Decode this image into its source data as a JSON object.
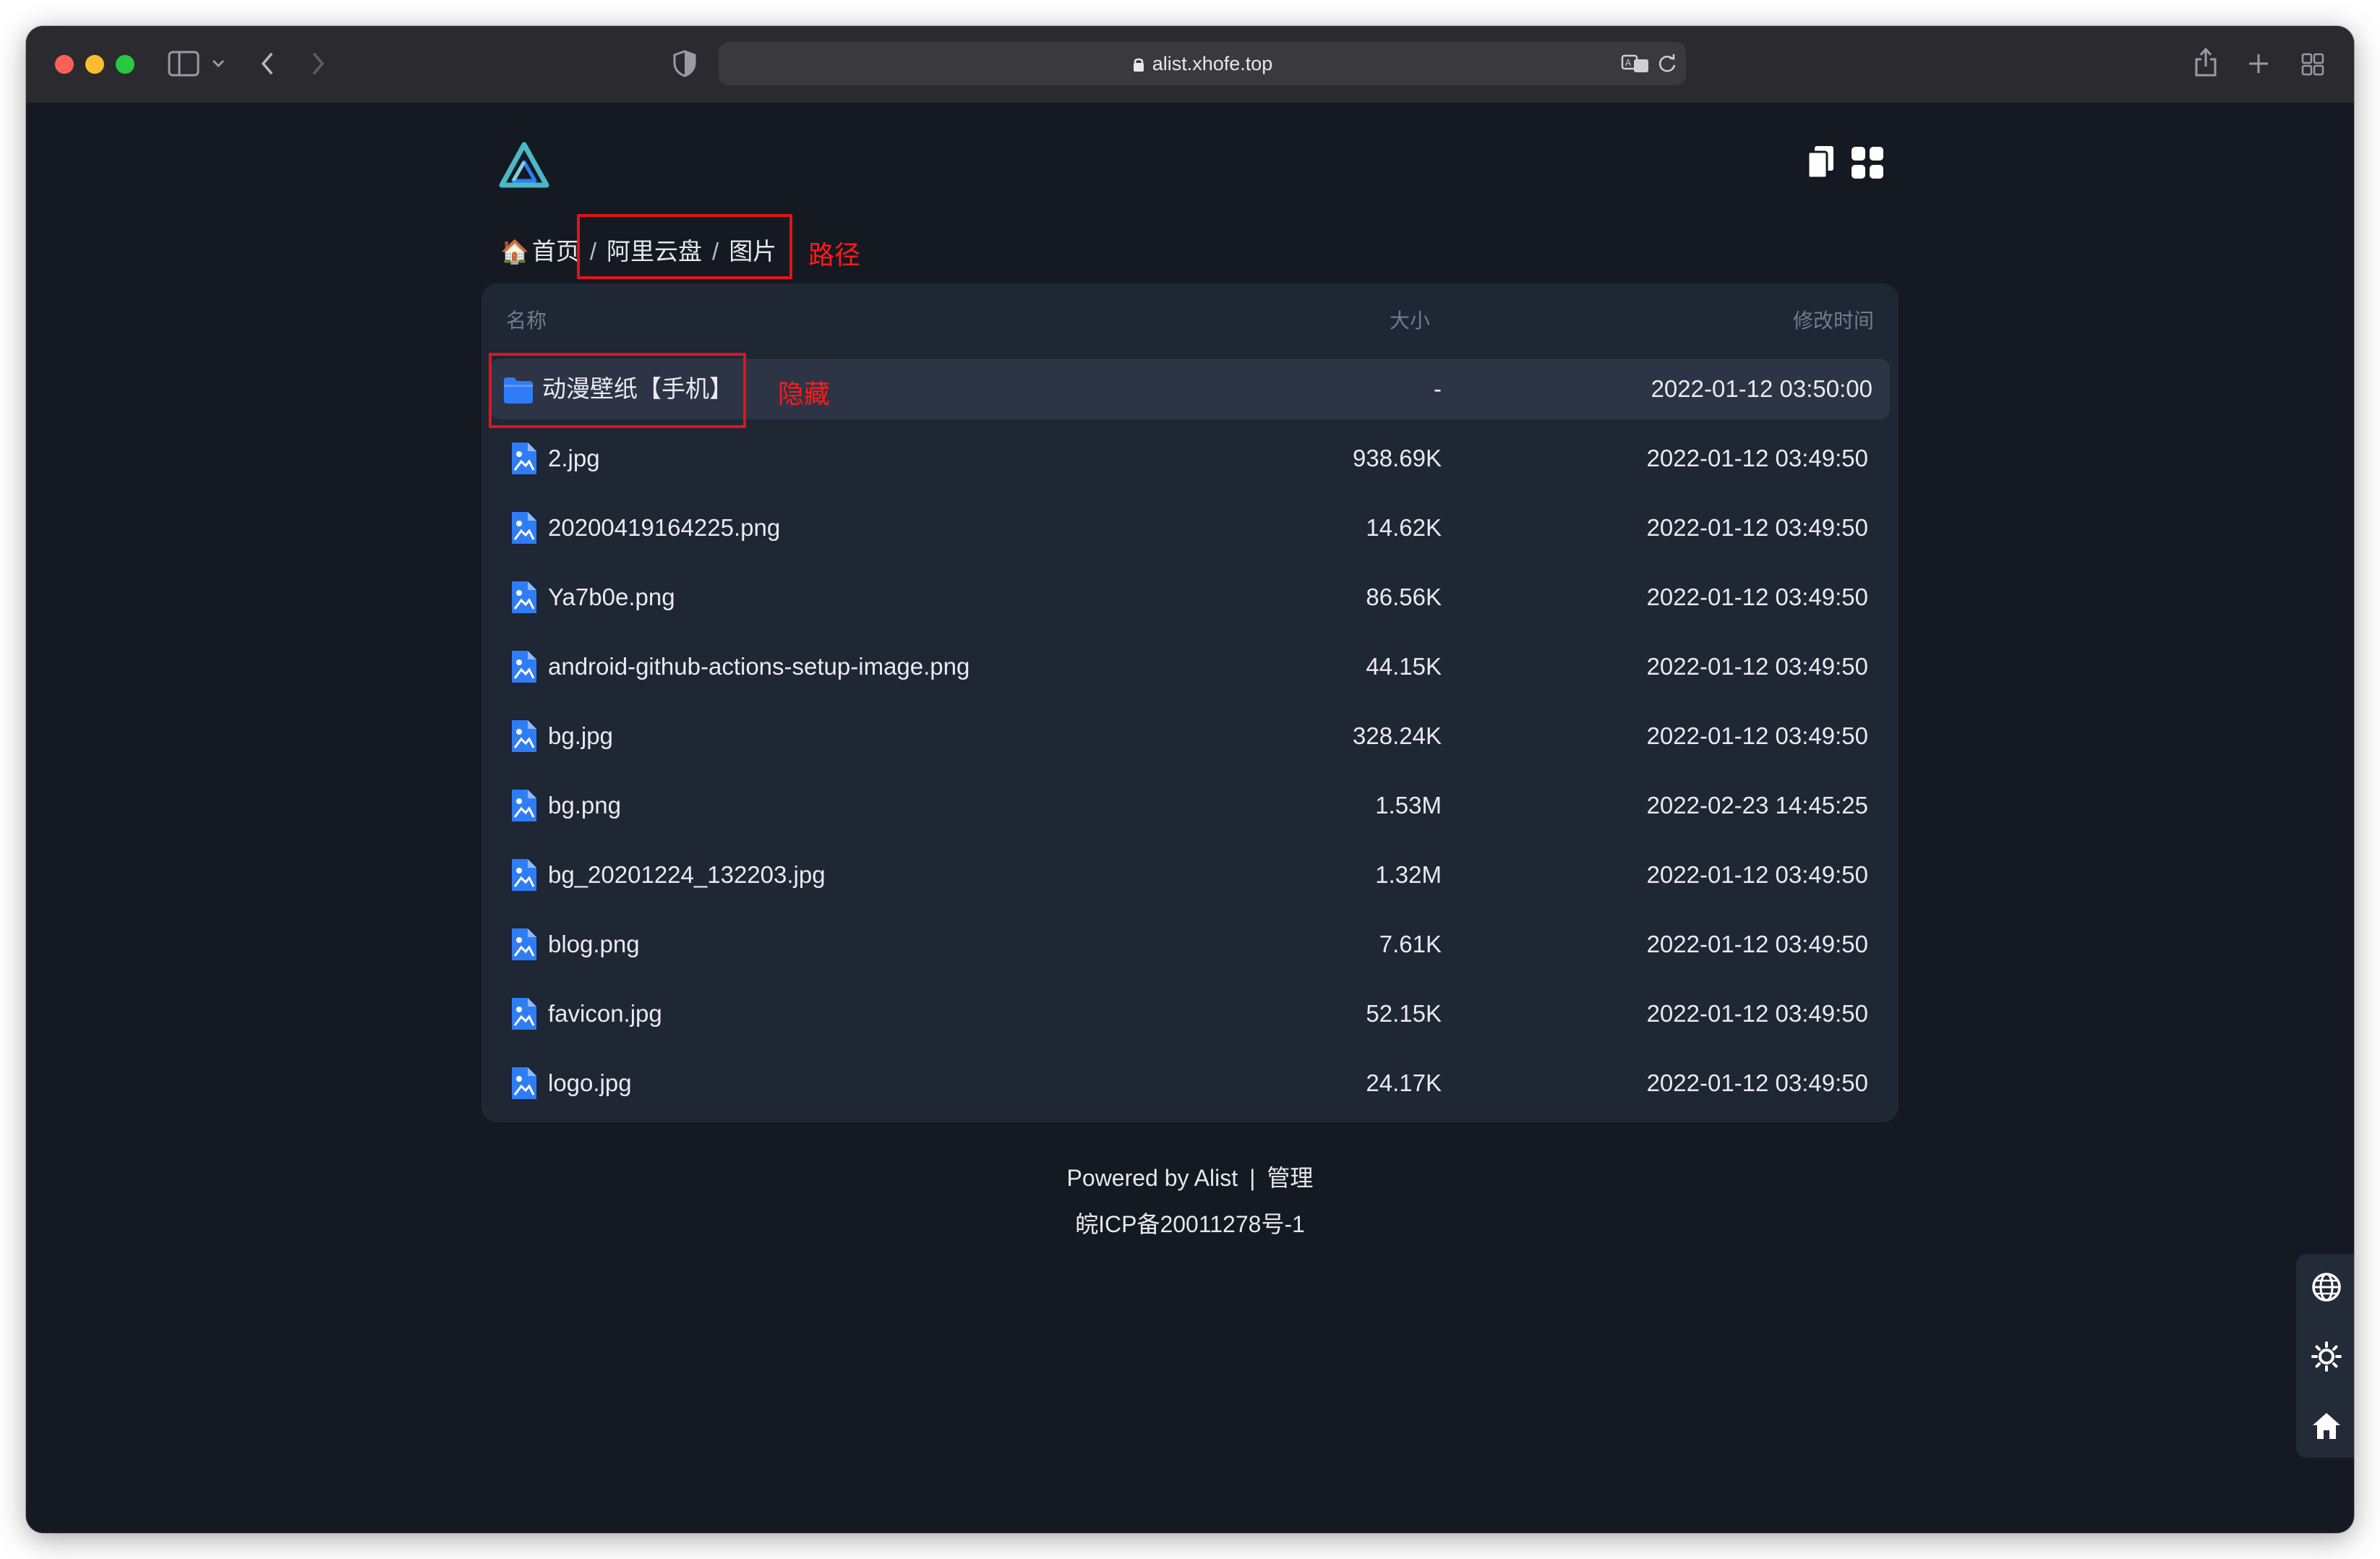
{
  "browser": {
    "url": "alist.xhofe.top"
  },
  "breadcrumb": {
    "home": "首页",
    "items": [
      "阿里云盘",
      "图片"
    ],
    "separator": "/"
  },
  "annotations": {
    "path_label": "路径",
    "hidden_label": "隐藏",
    "color": "#e0141b"
  },
  "table": {
    "headers": {
      "name": "名称",
      "size": "大小",
      "modified": "修改时间"
    },
    "rows": [
      {
        "type": "folder",
        "name": "动漫壁纸【手机】",
        "size": "-",
        "modified": "2022-01-12 03:50:00"
      },
      {
        "type": "image",
        "name": "2.jpg",
        "size": "938.69K",
        "modified": "2022-01-12 03:49:50"
      },
      {
        "type": "image",
        "name": "20200419164225.png",
        "size": "14.62K",
        "modified": "2022-01-12 03:49:50"
      },
      {
        "type": "image",
        "name": "Ya7b0e.png",
        "size": "86.56K",
        "modified": "2022-01-12 03:49:50"
      },
      {
        "type": "image",
        "name": "android-github-actions-setup-image.png",
        "size": "44.15K",
        "modified": "2022-01-12 03:49:50"
      },
      {
        "type": "image",
        "name": "bg.jpg",
        "size": "328.24K",
        "modified": "2022-01-12 03:49:50"
      },
      {
        "type": "image",
        "name": "bg.png",
        "size": "1.53M",
        "modified": "2022-02-23 14:45:25"
      },
      {
        "type": "image",
        "name": "bg_20201224_132203.jpg",
        "size": "1.32M",
        "modified": "2022-01-12 03:49:50"
      },
      {
        "type": "image",
        "name": "blog.png",
        "size": "7.61K",
        "modified": "2022-01-12 03:49:50"
      },
      {
        "type": "image",
        "name": "favicon.jpg",
        "size": "52.15K",
        "modified": "2022-01-12 03:49:50"
      },
      {
        "type": "image",
        "name": "logo.jpg",
        "size": "24.17K",
        "modified": "2022-01-12 03:49:50"
      }
    ]
  },
  "footer": {
    "powered": "Powered by Alist",
    "separator": "|",
    "admin": "管理",
    "icp": "皖ICP备20011278号-1"
  },
  "icons": {
    "logo": "alist-logo-icon",
    "copy": "copy-icon",
    "grid": "grid-view-icon",
    "language": "globe-icon",
    "theme": "sun-icon",
    "home": "home-icon"
  },
  "colors": {
    "background": "#141922",
    "panel": "#1f2634",
    "accent": "#2f7df6"
  }
}
